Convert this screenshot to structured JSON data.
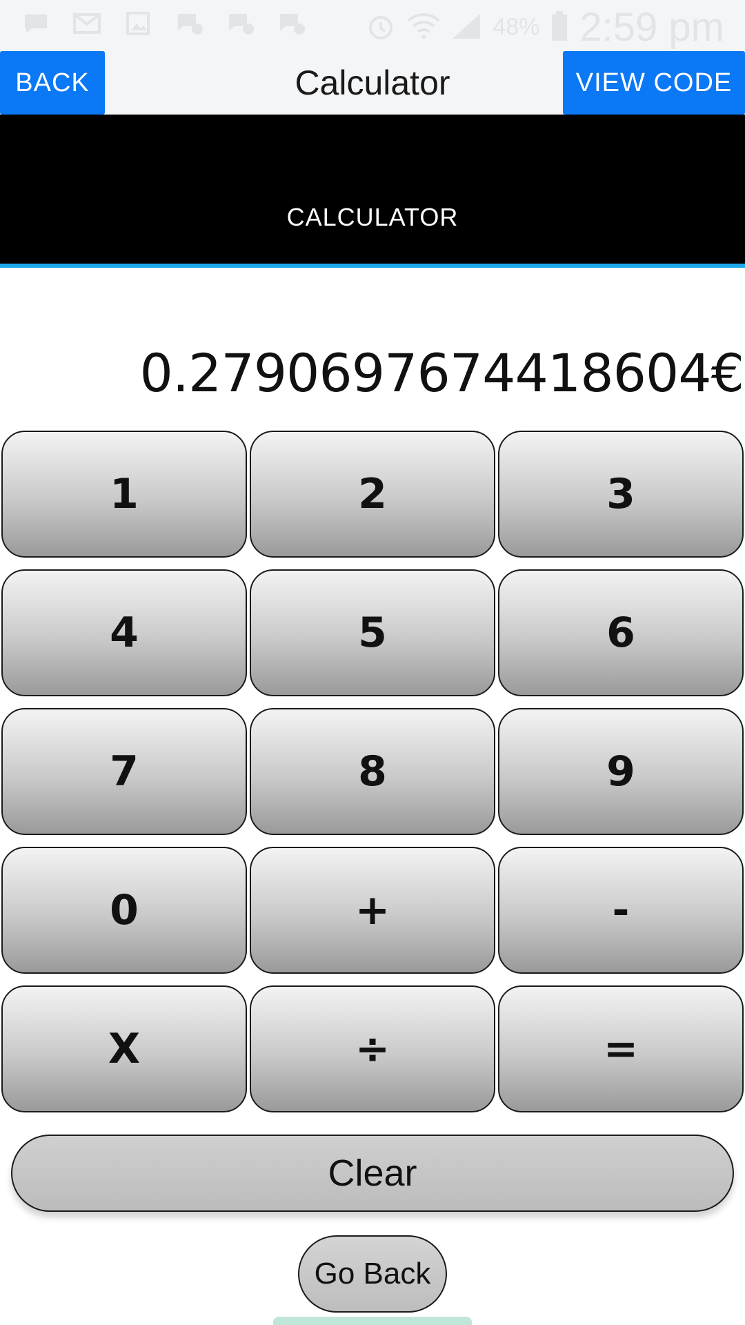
{
  "status_bar": {
    "battery": "48%",
    "time": "2:59 pm",
    "icons": [
      "chat-icon",
      "mail-icon",
      "image-icon",
      "app-icon",
      "app-icon",
      "app-icon",
      "alarm-icon",
      "wifi-icon",
      "signal-icon",
      "battery-icon"
    ]
  },
  "header": {
    "back_label": "BACK",
    "title": "Calculator",
    "view_code_label": "VIEW CODE"
  },
  "banner": {
    "title": "CALCULATOR"
  },
  "display": {
    "value": "0.2790697674418604€"
  },
  "keys": [
    {
      "label": "1",
      "name": "key-1"
    },
    {
      "label": "2",
      "name": "key-2"
    },
    {
      "label": "3",
      "name": "key-3"
    },
    {
      "label": "4",
      "name": "key-4"
    },
    {
      "label": "5",
      "name": "key-5"
    },
    {
      "label": "6",
      "name": "key-6"
    },
    {
      "label": "7",
      "name": "key-7"
    },
    {
      "label": "8",
      "name": "key-8"
    },
    {
      "label": "9",
      "name": "key-9"
    },
    {
      "label": "0",
      "name": "key-0"
    },
    {
      "label": "+",
      "name": "key-plus"
    },
    {
      "label": "-",
      "name": "key-minus"
    },
    {
      "label": "X",
      "name": "key-multiply"
    },
    {
      "label": "÷",
      "name": "key-divide"
    },
    {
      "label": "=",
      "name": "key-equals"
    }
  ],
  "actions": {
    "clear_label": "Clear",
    "go_back_label": "Go Back"
  },
  "colors": {
    "accent_blue": "#0b78f5",
    "banner_bg": "#000000",
    "banner_underline": "#1ea8ec",
    "status_bg": "#f4f5f7"
  }
}
